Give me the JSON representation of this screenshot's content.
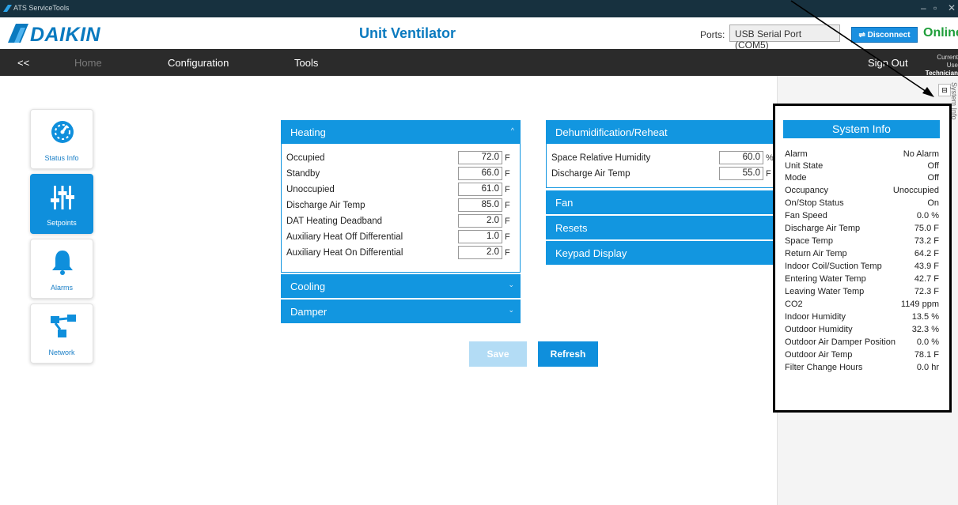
{
  "window": {
    "title": "ATS ServiceTools",
    "controls": [
      "–",
      "▫",
      "✕"
    ]
  },
  "header": {
    "logo_text": "DAIKIN",
    "app_name": "Unit Ventilator",
    "ports_label": "Ports:",
    "port_value": "USB Serial Port (COM5)",
    "disconnect_label": "Disconnect",
    "status": "Online"
  },
  "nav": {
    "back": "<<",
    "home": "Home",
    "configuration": "Configuration",
    "tools": "Tools",
    "sign_out": "Sign Out",
    "current_user_label": "Current Use",
    "current_user": "Technician"
  },
  "sidebar": {
    "items": [
      {
        "label": "Status Info",
        "icon": "gauge-icon"
      },
      {
        "label": "Setpoints",
        "icon": "sliders-icon",
        "active": true
      },
      {
        "label": "Alarms",
        "icon": "bell-icon"
      },
      {
        "label": "Network",
        "icon": "network-icon"
      }
    ]
  },
  "heating": {
    "title": "Heating",
    "chevron": "^",
    "rows": [
      {
        "label": "Occupied",
        "value": "72.0",
        "unit": "F"
      },
      {
        "label": "Standby",
        "value": "66.0",
        "unit": "F"
      },
      {
        "label": "Unoccupied",
        "value": "61.0",
        "unit": "F"
      },
      {
        "label": "Discharge Air Temp",
        "value": "85.0",
        "unit": "F"
      },
      {
        "label": "DAT Heating Deadband",
        "value": "2.0",
        "unit": "F"
      },
      {
        "label": "Auxiliary Heat Off Differential",
        "value": "1.0",
        "unit": "F"
      },
      {
        "label": "Auxiliary Heat On Differential",
        "value": "2.0",
        "unit": "F"
      }
    ]
  },
  "cooling": {
    "title": "Cooling",
    "chevron": "⌄"
  },
  "damper": {
    "title": "Damper",
    "chevron": "⌄"
  },
  "dehum": {
    "title": "Dehumidification/Reheat",
    "rows": [
      {
        "label": "Space Relative Humidity",
        "value": "60.0",
        "unit": "%"
      },
      {
        "label": "Discharge Air Temp",
        "value": "55.0",
        "unit": "F"
      }
    ]
  },
  "fan": {
    "title": "Fan"
  },
  "resets": {
    "title": "Resets"
  },
  "keypad": {
    "title": "Keypad Display"
  },
  "buttons": {
    "save": "Save",
    "refresh": "Refresh"
  },
  "side_panel": {
    "tab_label": "System Info",
    "pin": "⊟",
    "title": "System Info",
    "rows": [
      {
        "k": "Alarm",
        "v": "No Alarm"
      },
      {
        "k": "Unit State",
        "v": "Off"
      },
      {
        "k": "Mode",
        "v": "Off"
      },
      {
        "k": "Occupancy",
        "v": "Unoccupied"
      },
      {
        "k": "On/Stop Status",
        "v": "On"
      },
      {
        "k": "Fan Speed",
        "v": "0.0 %"
      },
      {
        "k": "Discharge Air Temp",
        "v": "75.0 F"
      },
      {
        "k": "Space Temp",
        "v": "73.2 F"
      },
      {
        "k": "Return Air Temp",
        "v": "64.2 F"
      },
      {
        "k": "Indoor Coil/Suction Temp",
        "v": "43.9 F"
      },
      {
        "k": "Entering Water Temp",
        "v": "42.7 F"
      },
      {
        "k": "Leaving Water Temp",
        "v": "72.3 F"
      },
      {
        "k": "CO2",
        "v": "1149 ppm"
      },
      {
        "k": "Indoor Humidity",
        "v": "13.5 %"
      },
      {
        "k": "Outdoor Humidity",
        "v": "32.3 %"
      },
      {
        "k": "Outdoor Air Damper Position",
        "v": "0.0 %"
      },
      {
        "k": "Outdoor Air Temp",
        "v": "78.1 F"
      },
      {
        "k": "Filter Change Hours",
        "v": "0.0 hr"
      }
    ]
  },
  "colors": {
    "brand_blue": "#0a7abf",
    "accent_blue": "#1296e0",
    "online_green": "#1f9e3a",
    "navbar_bg": "#2b2b2b",
    "titlebar_bg": "#17313f"
  }
}
